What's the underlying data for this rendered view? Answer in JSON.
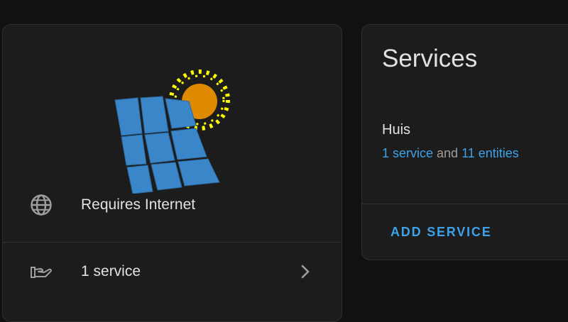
{
  "integration_card": {
    "logo_icon": "solar-panel-sun-logo",
    "requires_internet_label": "Requires Internet",
    "services_link_label": "1 service"
  },
  "services_card": {
    "title": "Services",
    "entry": {
      "name": "Huis",
      "service_link": "1 service",
      "joiner": " and ",
      "entities_link": "11 entities"
    },
    "add_button_label": "ADD SERVICE"
  },
  "colors": {
    "background": "#111111",
    "card": "#1c1c1c",
    "accent": "#3ea2e9",
    "text": "#e1e1e1",
    "panel_blue": "#3a86c8",
    "sun_orange": "#e08a00",
    "ray_yellow": "#ffff00"
  }
}
